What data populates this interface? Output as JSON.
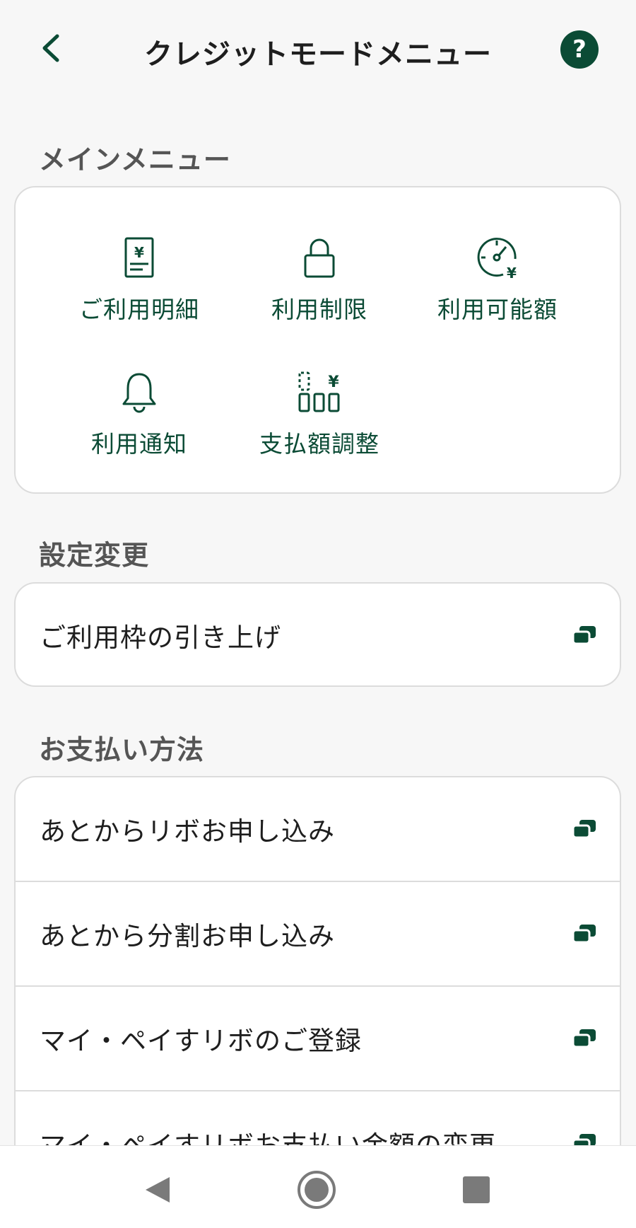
{
  "header": {
    "title": "クレジットモードメニュー",
    "back_icon": "chevron-left-icon",
    "help_label": "?"
  },
  "colors": {
    "accent": "#0b4b35",
    "background": "#f7f7f7",
    "card": "#ffffff"
  },
  "main_menu": {
    "heading": "メインメニュー",
    "items": [
      {
        "label": "ご利用明細",
        "icon": "statement-yen-icon"
      },
      {
        "label": "利用制限",
        "icon": "lock-icon"
      },
      {
        "label": "利用可能額",
        "icon": "gauge-yen-icon"
      },
      {
        "label": "利用通知",
        "icon": "bell-icon"
      },
      {
        "label": "支払額調整",
        "icon": "payment-adjust-icon"
      }
    ]
  },
  "settings": {
    "heading": "設定変更",
    "items": [
      {
        "label": "ご利用枠の引き上げ",
        "icon": "external-link-icon"
      }
    ]
  },
  "payment": {
    "heading": "お支払い方法",
    "items": [
      {
        "label": "あとからリボお申し込み",
        "icon": "external-link-icon"
      },
      {
        "label": "あとから分割お申し込み",
        "icon": "external-link-icon"
      },
      {
        "label": "マイ・ペイすリボのご登録",
        "icon": "external-link-icon"
      },
      {
        "label": "マイ・ペイすリボお支払い金額の変更",
        "icon": "external-link-icon"
      }
    ]
  },
  "nav": {
    "back": "nav-back-icon",
    "home": "nav-home-icon",
    "recents": "nav-recents-icon"
  }
}
